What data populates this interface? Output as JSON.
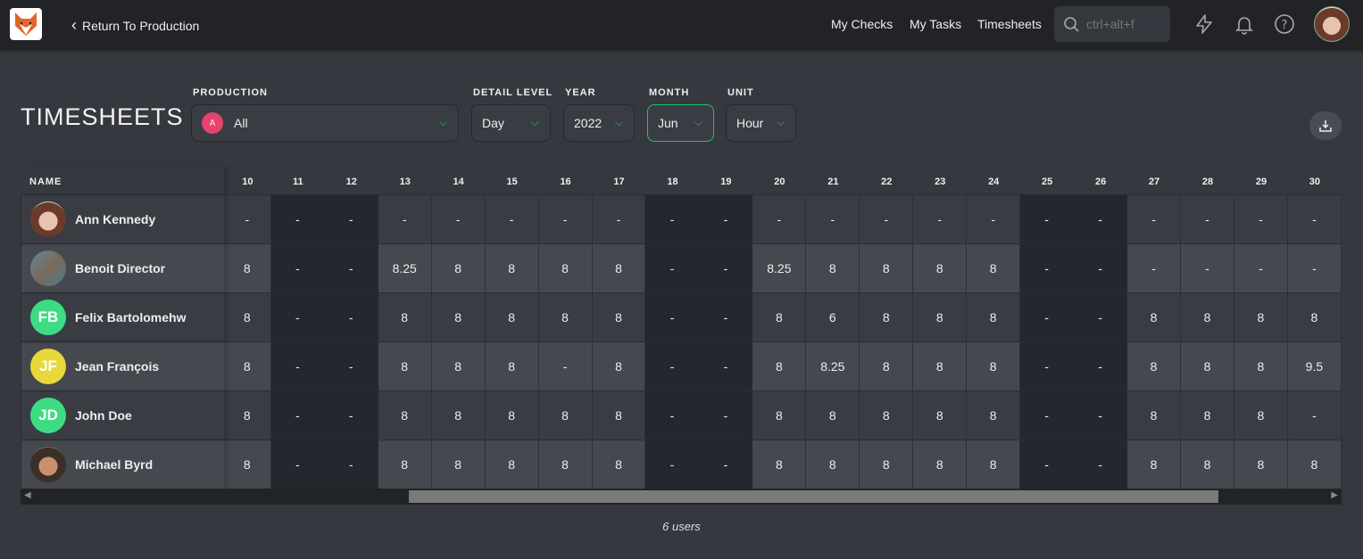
{
  "topbar": {
    "back_label": "Return To Production",
    "nav": [
      "My Checks",
      "My Tasks",
      "Timesheets"
    ],
    "search_placeholder": "ctrl+alt+f",
    "icons": [
      "lightning-icon",
      "bell-icon",
      "help-icon"
    ]
  },
  "page": {
    "title": "TIMESHEETS"
  },
  "filters": {
    "production": {
      "label": "PRODUCTION",
      "value": "All",
      "avatar": "A",
      "avatar_color": "#e6436d"
    },
    "detail": {
      "label": "DETAIL LEVEL",
      "value": "Day"
    },
    "year": {
      "label": "YEAR",
      "value": "2022"
    },
    "month": {
      "label": "MONTH",
      "value": "Jun"
    },
    "unit": {
      "label": "UNIT",
      "value": "Hour"
    }
  },
  "table": {
    "name_header": "NAME",
    "days": [
      "10",
      "11",
      "12",
      "13",
      "14",
      "15",
      "16",
      "17",
      "18",
      "19",
      "20",
      "21",
      "22",
      "23",
      "24",
      "25",
      "26",
      "27",
      "28",
      "29",
      "30"
    ],
    "weekend_days": [
      "11",
      "12",
      "18",
      "19",
      "25",
      "26"
    ],
    "rows": [
      {
        "name": "Ann Kennedy",
        "avatar": "photo",
        "values": [
          "-",
          "-",
          "-",
          "-",
          "-",
          "-",
          "-",
          "-",
          "-",
          "-",
          "-",
          "-",
          "-",
          "-",
          "-",
          "-",
          "-",
          "-",
          "-",
          "-",
          "-"
        ]
      },
      {
        "name": "Benoit Director",
        "avatar": "photo",
        "values": [
          "8",
          "-",
          "-",
          "8.25",
          "8",
          "8",
          "8",
          "8",
          "-",
          "-",
          "8.25",
          "8",
          "8",
          "8",
          "8",
          "-",
          "-",
          "-",
          "-",
          "-",
          "-"
        ]
      },
      {
        "name": "Felix Bartolomehw",
        "avatar": "FB",
        "avatar_color": "#3ddc84",
        "values": [
          "8",
          "-",
          "-",
          "8",
          "8",
          "8",
          "8",
          "8",
          "-",
          "-",
          "8",
          "6",
          "8",
          "8",
          "8",
          "-",
          "-",
          "8",
          "8",
          "8",
          "8"
        ]
      },
      {
        "name": "Jean François",
        "avatar": "JF",
        "avatar_color": "#e8d83a",
        "values": [
          "8",
          "-",
          "-",
          "8",
          "8",
          "8",
          "-",
          "8",
          "-",
          "-",
          "8",
          "8.25",
          "8",
          "8",
          "8",
          "-",
          "-",
          "8",
          "8",
          "8",
          "9.5"
        ]
      },
      {
        "name": "John Doe",
        "avatar": "JD",
        "avatar_color": "#3ddc84",
        "values": [
          "8",
          "-",
          "-",
          "8",
          "8",
          "8",
          "8",
          "8",
          "-",
          "-",
          "8",
          "8",
          "8",
          "8",
          "8",
          "-",
          "-",
          "8",
          "8",
          "8",
          "-"
        ]
      },
      {
        "name": "Michael Byrd",
        "avatar": "photo",
        "values": [
          "8",
          "-",
          "-",
          "8",
          "8",
          "8",
          "8",
          "8",
          "-",
          "-",
          "8",
          "8",
          "8",
          "8",
          "8",
          "-",
          "-",
          "8",
          "8",
          "8",
          "8"
        ]
      }
    ]
  },
  "footer": {
    "count": "6 users"
  },
  "colors": {
    "accent": "#1ec36b",
    "background": "#36383f",
    "topbar": "#222327"
  }
}
